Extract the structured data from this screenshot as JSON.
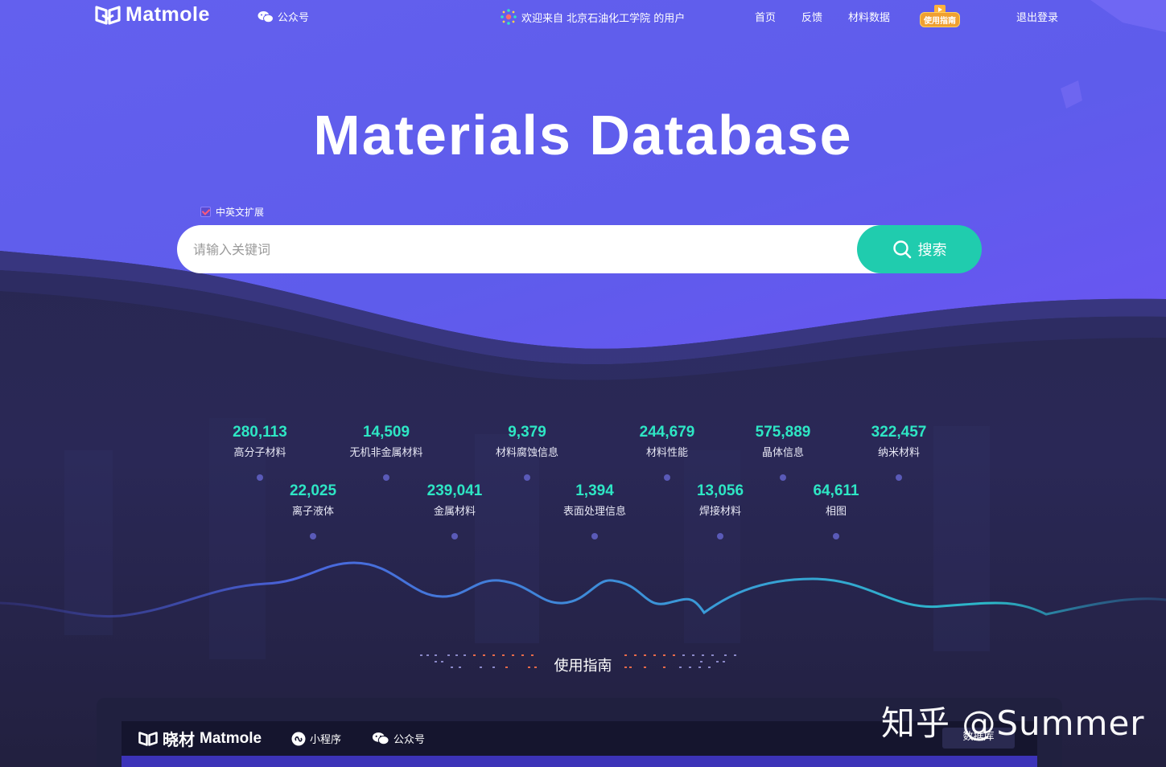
{
  "header": {
    "logo_text": "Matmole",
    "wechat_label": "公众号",
    "welcome_text": "欢迎来自 北京石油化工学院 的用户",
    "nav": [
      "首页",
      "反馈",
      "材料数据"
    ],
    "guide_badge": "使用指南",
    "logout": "退出登录"
  },
  "hero": {
    "title": "Materials Database",
    "extension_checkbox_label": "中英文扩展",
    "extension_checked": true,
    "search_placeholder": "请输入关键词",
    "search_button": "搜索"
  },
  "stats": {
    "top_row": [
      {
        "value": "280,113",
        "label": "高分子材料"
      },
      {
        "value": "14,509",
        "label": "无机非金属材料"
      },
      {
        "value": "9,379",
        "label": "材料腐蚀信息"
      },
      {
        "value": "244,679",
        "label": "材料性能"
      },
      {
        "value": "575,889",
        "label": "晶体信息"
      },
      {
        "value": "322,457",
        "label": "纳米材料"
      }
    ],
    "bottom_row": [
      {
        "value": "22,025",
        "label": "离子液体"
      },
      {
        "value": "239,041",
        "label": "金属材料"
      },
      {
        "value": "1,394",
        "label": "表面处理信息"
      },
      {
        "value": "13,056",
        "label": "焊接材料"
      },
      {
        "value": "64,611",
        "label": "相图"
      }
    ]
  },
  "guide": {
    "heading": "使用指南"
  },
  "bottom_panel": {
    "logo_cn": "晓材",
    "logo_en": "Matmole",
    "mini_program": "小程序",
    "wechat": "公众号",
    "database_button": "数据库"
  },
  "watermark": "知乎 @Summer",
  "colors": {
    "hero_top": "#6a63f0",
    "hero_bottom": "#5b55e6",
    "dark_bg": "#232348",
    "accent_teal": "#20ccae",
    "stat_number": "#2ee6c4"
  }
}
